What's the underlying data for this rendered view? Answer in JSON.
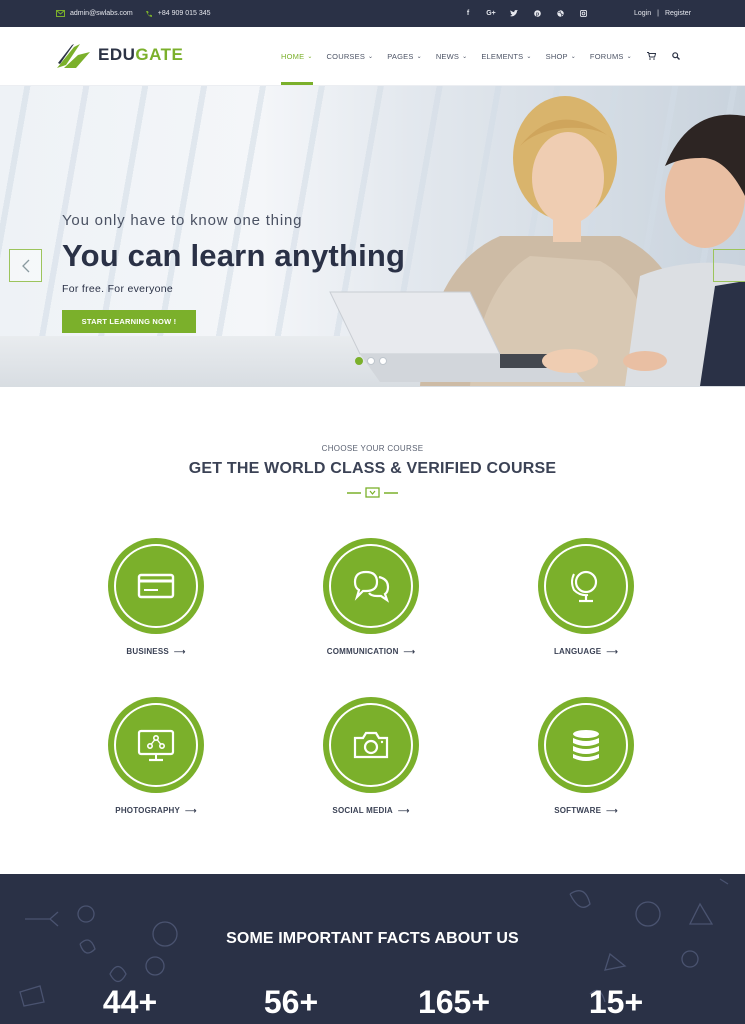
{
  "topbar": {
    "email": "admin@swlabs.com",
    "phone": "+84 909 015 345",
    "social_icons": [
      "facebook-icon",
      "google-plus-icon",
      "twitter-icon",
      "pinterest-icon",
      "dribbble-icon",
      "instagram-icon"
    ],
    "login": "Login",
    "separator": "|",
    "register": "Register"
  },
  "header": {
    "logo_part1": "EDU",
    "logo_part2": "GATE",
    "nav": [
      {
        "label": "HOME",
        "active": true
      },
      {
        "label": "COURSES"
      },
      {
        "label": "PAGES"
      },
      {
        "label": "NEWS"
      },
      {
        "label": "ELEMENTS"
      },
      {
        "label": "SHOP"
      },
      {
        "label": "FORUMS"
      }
    ],
    "icons": [
      "cart-icon",
      "search-icon"
    ]
  },
  "hero": {
    "subtitle": "You only have to know one thing",
    "title": "You can learn anything",
    "tagline": "For free. For everyone",
    "button": "START LEARNING NOW !",
    "slides": 3,
    "active_slide": 1
  },
  "courses": {
    "kicker": "CHOOSE YOUR COURSE",
    "title": "GET THE WORLD CLASS & VERIFIED COURSE",
    "items": [
      {
        "label": "BUSINESS",
        "icon": "credit-card-icon"
      },
      {
        "label": "COMMUNICATION",
        "icon": "chat-bubbles-icon"
      },
      {
        "label": "LANGUAGE",
        "icon": "globe-icon"
      },
      {
        "label": "PHOTOGRAPHY",
        "icon": "monitor-icon"
      },
      {
        "label": "SOCIAL MEDIA",
        "icon": "camera-icon"
      },
      {
        "label": "SOFTWARE",
        "icon": "database-icon"
      }
    ]
  },
  "facts": {
    "title": "SOME IMPORTANT FACTS ABOUT US",
    "values": [
      "44+",
      "56+",
      "165+",
      "15+"
    ]
  },
  "colors": {
    "accent": "#7bb02b",
    "dark": "#2a3146"
  }
}
